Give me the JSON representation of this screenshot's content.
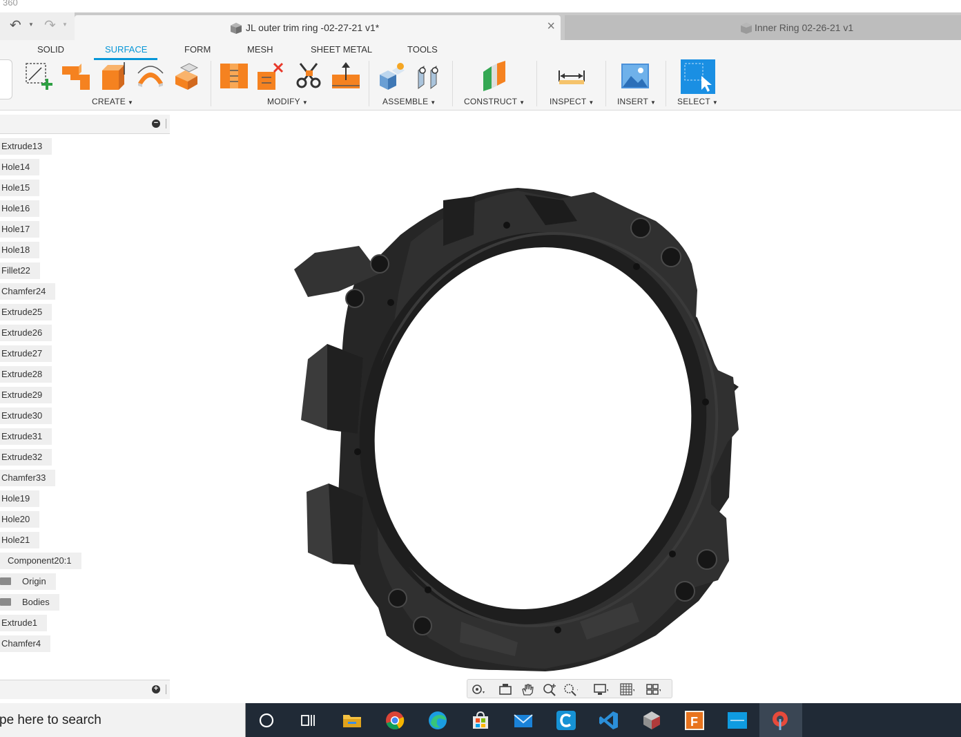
{
  "app": {
    "title": "360"
  },
  "tabs": [
    {
      "label": "JL outer trim ring -02-27-21 v1*",
      "active": true
    },
    {
      "label": "Inner Ring 02-26-21 v1",
      "active": false
    }
  ],
  "ribbon": {
    "workspace_tabs": [
      "SOLID",
      "SURFACE",
      "FORM",
      "MESH",
      "SHEET METAL",
      "TOOLS"
    ],
    "active_tab": "SURFACE",
    "groups": {
      "create": "CREATE",
      "modify": "MODIFY",
      "assemble": "ASSEMBLE",
      "construct": "CONSTRUCT",
      "inspect": "INSPECT",
      "insert": "INSERT",
      "select": "SELECT"
    }
  },
  "browser": {
    "items": [
      "Extrude13",
      "Hole14",
      "Hole15",
      "Hole16",
      "Hole17",
      "Hole18",
      "Fillet22",
      "Chamfer24",
      "Extrude25",
      "Extrude26",
      "Extrude27",
      "Extrude28",
      "Extrude29",
      "Extrude30",
      "Extrude31",
      "Extrude32",
      "Chamfer33",
      "Hole19",
      "Hole20",
      "Hole21",
      "Component20:1",
      "Origin",
      "Bodies",
      "Extrude1",
      "Chamfer4"
    ]
  },
  "taskbar": {
    "search_placeholder": "pe here to search"
  },
  "colors": {
    "accent": "#0696d7",
    "model": "#2b2b2b",
    "taskbar": "#202a36"
  }
}
